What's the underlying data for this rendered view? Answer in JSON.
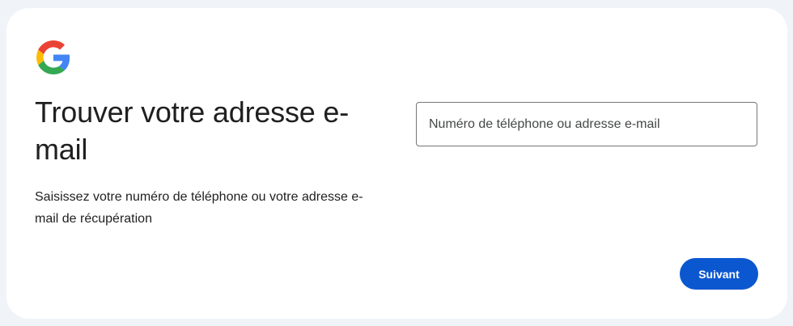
{
  "logo": {
    "icon": "google-g-icon",
    "colors": {
      "blue": "#4285F4",
      "red": "#EA4335",
      "yellow": "#FBBC05",
      "green": "#34A853"
    }
  },
  "heading": {
    "title": "Trouver votre adresse e-mail",
    "subtitle": "Saisissez votre numéro de téléphone ou votre adresse e-mail de récupération"
  },
  "form": {
    "identifier_placeholder": "Numéro de téléphone ou adresse e-mail",
    "identifier_value": ""
  },
  "actions": {
    "next_label": "Suivant",
    "accent_color": "#0b57d0"
  }
}
